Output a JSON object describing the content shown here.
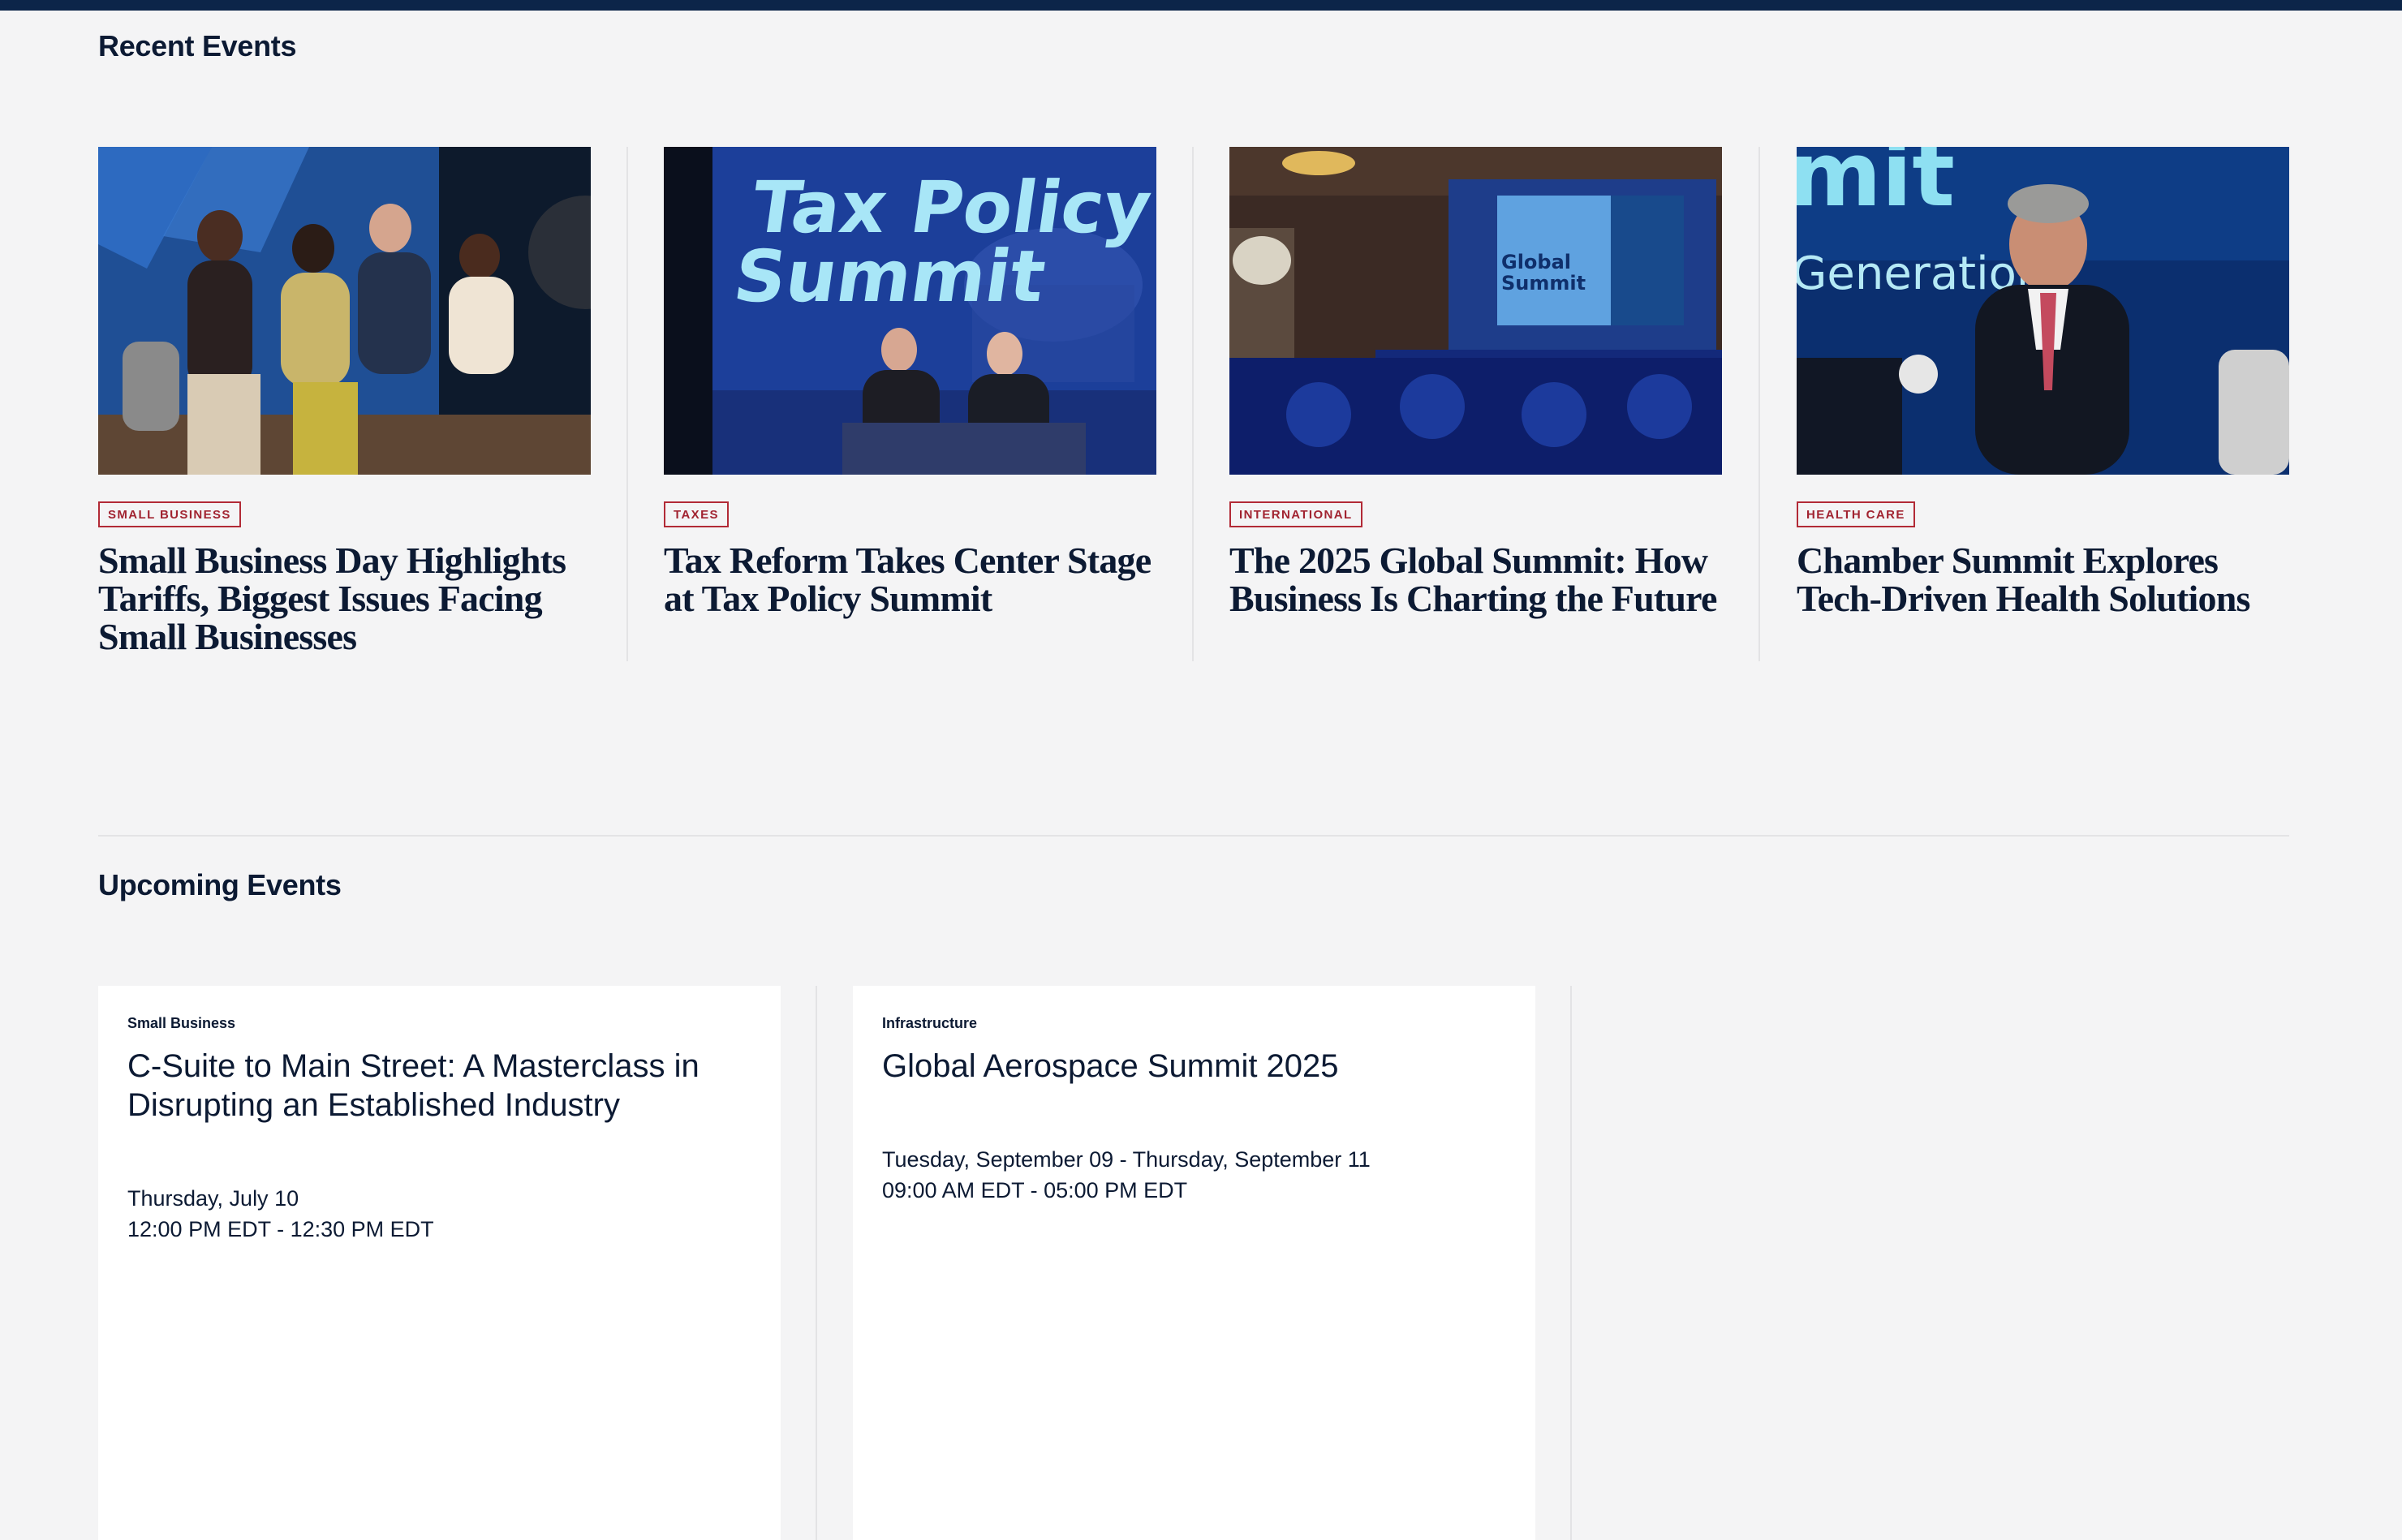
{
  "recent": {
    "title": "Recent Events",
    "items": [
      {
        "tag": "SMALL BUSINESS",
        "headline": "Small Business Day Highlights Tariffs, Biggest Issues Facing Small Businesses"
      },
      {
        "tag": "TAXES",
        "headline": "Tax Reform Takes Center Stage at Tax Policy Summit",
        "image_text": [
          "Tax Policy",
          "Summit"
        ]
      },
      {
        "tag": "INTERNATIONAL",
        "headline": "The 2025 Global Summit: How Business Is Charting the Future",
        "image_text": [
          "Global",
          "Summit"
        ]
      },
      {
        "tag": "HEALTH CARE",
        "headline": "Chamber Summit Explores Tech-Driven Health Solutions",
        "image_text": [
          "mit",
          "Generation"
        ]
      }
    ]
  },
  "upcoming": {
    "title": "Upcoming Events",
    "items": [
      {
        "category": "Small Business",
        "title": "C-Suite to Main Street: A Masterclass in Disrupting an Established Industry",
        "date": "Thursday, July 10",
        "time": "12:00 PM EDT - 12:30 PM EDT"
      },
      {
        "category": "Infrastructure",
        "title": "Global Aerospace Summit 2025",
        "date": "Tuesday, September 09 - Thursday, September 11",
        "time": "09:00 AM EDT - 05:00 PM EDT"
      }
    ]
  },
  "colors": {
    "page_bg": "#f4f4f5",
    "top_bar": "#0c2549",
    "tag_red": "#b22a36",
    "text_dark": "#0c1a33"
  }
}
